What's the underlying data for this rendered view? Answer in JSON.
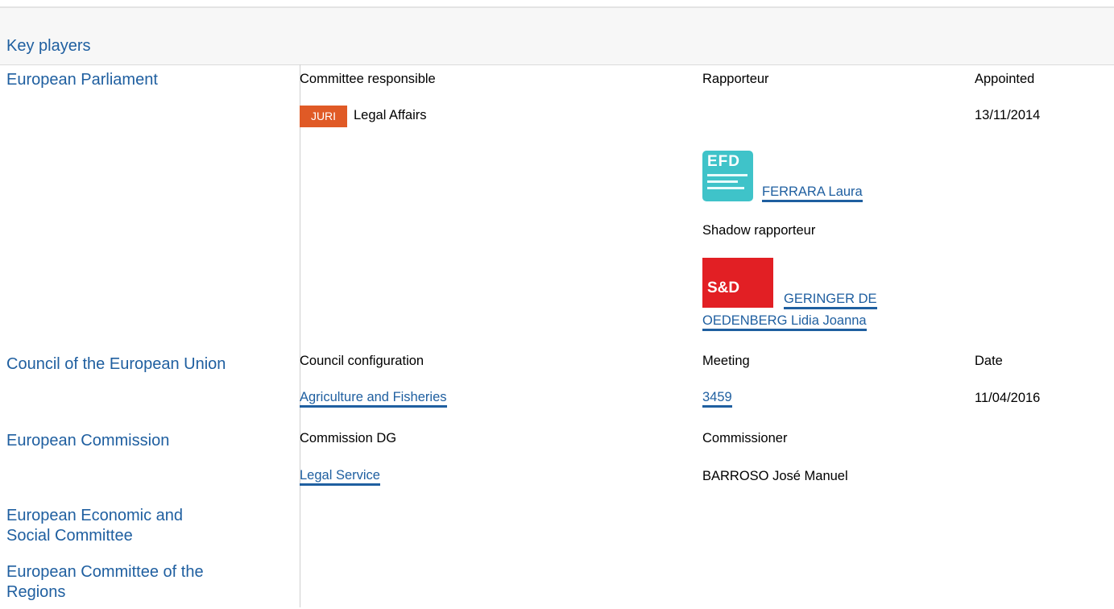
{
  "header": {
    "title": "Key players"
  },
  "parliament": {
    "name": "European Parliament",
    "committee_header": "Committee responsible",
    "rapporteur_header": "Rapporteur",
    "appointed_header": "Appointed",
    "committee_code": "JURI",
    "committee_name": "Legal Affairs",
    "appointed_date": "13/11/2014",
    "rapporteur": {
      "group_logo": "EFD",
      "name": "FERRARA Laura"
    },
    "shadow_header": "Shadow rapporteur",
    "shadow": {
      "group_logo": "S&D",
      "name_line1": "GERINGER DE",
      "name_line2": "OEDENBERG Lidia Joanna"
    }
  },
  "council": {
    "name": "Council of the European Union",
    "configuration_header": "Council configuration",
    "meeting_header": "Meeting",
    "date_header": "Date",
    "configuration": "Agriculture and Fisheries",
    "meeting": "3459",
    "date": "11/04/2016"
  },
  "commission": {
    "name": "European Commission",
    "dg_header": "Commission DG",
    "commissioner_header": "Commissioner",
    "dg": "Legal Service",
    "commissioner": "BARROSO José Manuel"
  },
  "eesc": {
    "name_line1": "European Economic and",
    "name_line2": "Social Committee"
  },
  "cor": {
    "name_line1": "European Committee of the",
    "name_line2": "Regions"
  },
  "colors": {
    "accent": "#1f5fa0",
    "juri_badge": "#e05a26",
    "efd": "#3fc3c9",
    "sd": "#e21f24"
  }
}
